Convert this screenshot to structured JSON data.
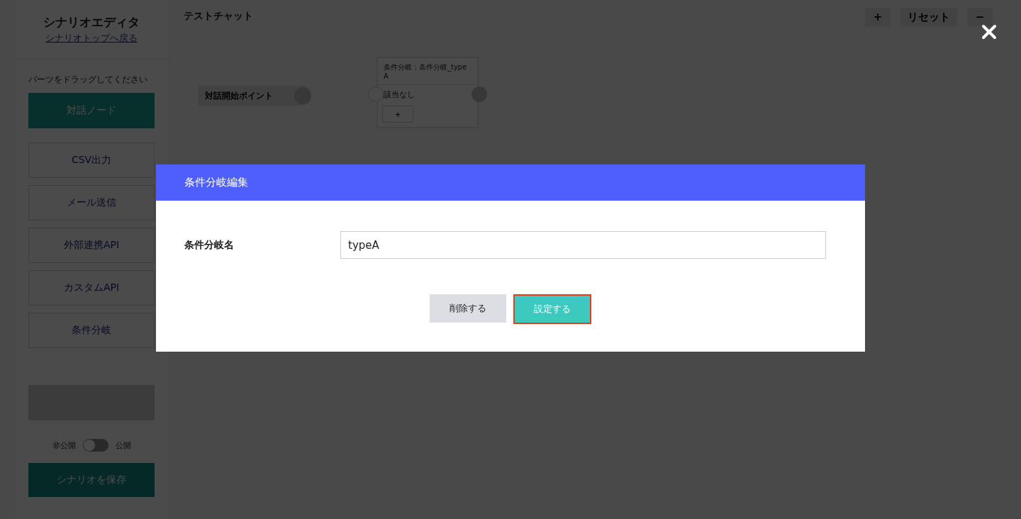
{
  "sidebar": {
    "title": "シナリオエディタ",
    "back_link": "シナリオトップへ戻る",
    "hint": "パーツをドラッグしてください",
    "parts": [
      {
        "label": "対話ノード",
        "kind": "primary"
      },
      {
        "label": "CSV出力",
        "kind": "outline"
      },
      {
        "label": "メール送信",
        "kind": "outline"
      },
      {
        "label": "外部連携API",
        "kind": "outline"
      },
      {
        "label": "カスタムAPI",
        "kind": "outline"
      },
      {
        "label": "条件分岐",
        "kind": "outline"
      }
    ],
    "publish_toggle": {
      "off_label": "非公開",
      "on_label": "公開",
      "on": false
    },
    "save_button": "シナリオを保存"
  },
  "canvas": {
    "title": "テストチャット",
    "toolbar": [
      "+",
      "リセット",
      "−"
    ],
    "start_node": {
      "label": "対話開始ポイント"
    },
    "branch_node": {
      "title": "条件分岐：条件分岐_typeA",
      "rows": [
        "該当なし"
      ],
      "add_button": "+"
    }
  },
  "dialog": {
    "title": "条件分岐編集",
    "field_label": "条件分岐名",
    "field_value": "typeA",
    "buttons": [
      {
        "label": "削除する",
        "kind": "secondary",
        "highlighted": false
      },
      {
        "label": "設定する",
        "kind": "primary",
        "highlighted": true
      }
    ]
  }
}
